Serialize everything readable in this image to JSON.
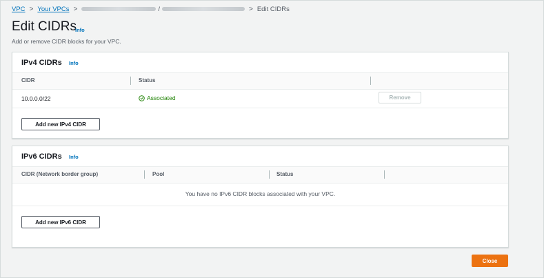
{
  "breadcrumb": {
    "items": [
      "VPC",
      "Your VPCs"
    ],
    "current": "Edit CIDRs",
    "separator": ">"
  },
  "header": {
    "title": "Edit CIDRs",
    "info_label": "Info",
    "description": "Add or remove CIDR blocks for your VPC."
  },
  "ipv4": {
    "title": "IPv4 CIDRs",
    "info_label": "Info",
    "columns": [
      "CIDR",
      "Status"
    ],
    "rows": [
      {
        "cidr": "10.0.0.0/22",
        "status": "Associated",
        "action": "Remove"
      }
    ],
    "add_button": "Add new IPv4 CIDR"
  },
  "ipv6": {
    "title": "IPv6 CIDRs",
    "info_label": "Info",
    "columns": [
      "CIDR (Network border group)",
      "Pool",
      "Status"
    ],
    "empty_message": "You have no IPv6 CIDR blocks associated with your VPC.",
    "add_button": "Add new IPv6 CIDR"
  },
  "footer": {
    "close_button": "Close"
  },
  "colors": {
    "link": "#0073bb",
    "success": "#1d8102",
    "primary": "#ec7211"
  },
  "icons": {
    "separator": "chevron-right-icon",
    "status": "check-circle-icon"
  }
}
